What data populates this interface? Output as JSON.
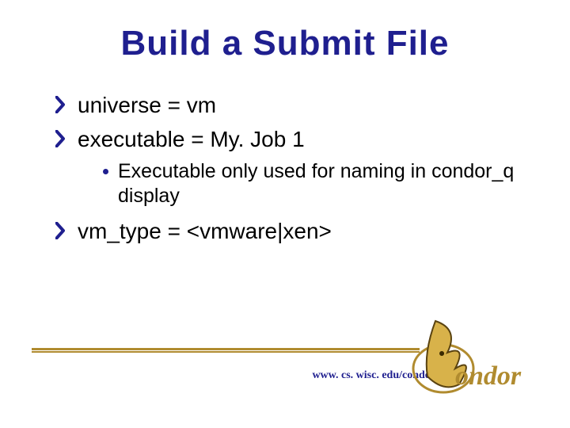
{
  "title": "Build a Submit File",
  "bullets": {
    "b1": "universe = vm",
    "b2": "executable = My. Job 1",
    "b2_sub": "Executable only used for naming in condor_q display",
    "b3": "vm_type = <vmware|xen>"
  },
  "footer_url": "www. cs. wisc. edu/condor",
  "logo_text": "ondor",
  "colors": {
    "accent": "#1f1f8f",
    "gold": "#b08b2f",
    "gold_light": "#d8b24a"
  }
}
